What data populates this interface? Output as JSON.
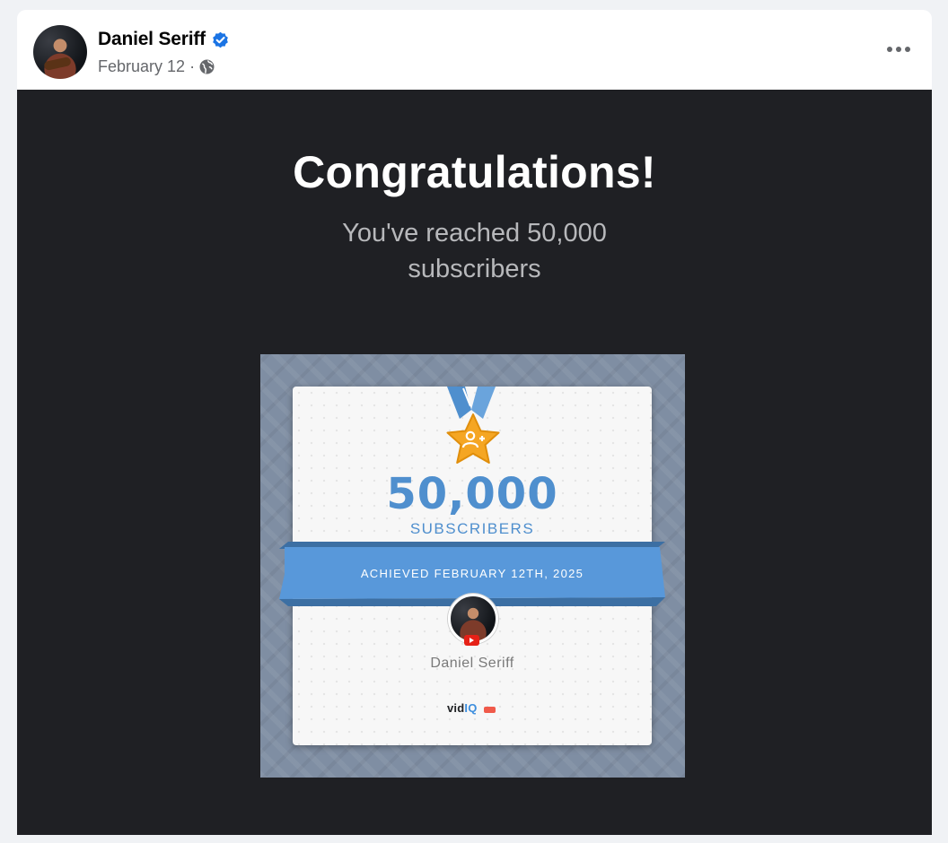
{
  "post": {
    "author": "Daniel Seriff",
    "date": "February 12",
    "separator": "·",
    "icons": {
      "verified": "verified-badge-icon",
      "audience": "globe-icon",
      "menu": "more-options-icon"
    },
    "colors": {
      "verified": "#1b74e4",
      "meta_text": "#65676b"
    }
  },
  "image": {
    "title": "Congratulations!",
    "subtitle_line1": "You've reached 50,000",
    "subtitle_line2": "subscribers",
    "colors": {
      "background": "#1f2024",
      "accent_blue": "#4f8fce",
      "medal_gold": "#f5a623"
    },
    "certificate": {
      "count": "50,000",
      "count_label": "SUBSCRIBERS",
      "achieved": "ACHIEVED FEBRUARY 12TH, 2025",
      "channel_name": "Daniel Seriff",
      "brand_vid": "vid",
      "brand_iq": "IQ",
      "icons": {
        "medal": "star-medal-icon",
        "badge_glyph": "add-user-icon",
        "platform": "youtube-icon"
      }
    }
  }
}
